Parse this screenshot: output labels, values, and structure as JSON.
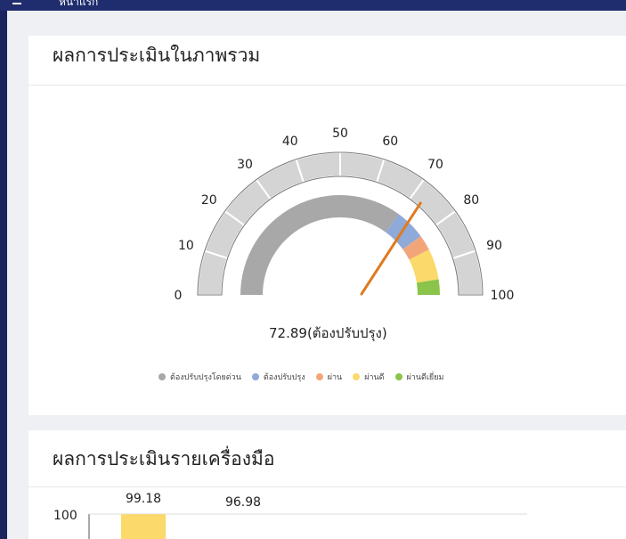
{
  "topbar": {
    "title": "หน้าแรก"
  },
  "overview": {
    "title": "ผลการประเมินในภาพรวม",
    "gauge": {
      "value": 72.89,
      "value_label": "72.89(ต้องปรับปรุง)",
      "ticks": [
        "0",
        "10",
        "20",
        "30",
        "40",
        "50",
        "60",
        "70",
        "80",
        "90",
        "100"
      ],
      "bands": [
        {
          "name": "ต้องปรับปรุงโดยด่วน",
          "from": 0,
          "to": 70,
          "color": "#a8a8a8"
        },
        {
          "name": "ต้องปรับปรุง",
          "from": 70,
          "to": 80,
          "color": "#8fa9d8"
        },
        {
          "name": "ผ่าน",
          "from": 80,
          "to": 85,
          "color": "#f3a57a"
        },
        {
          "name": "ผ่านดี",
          "from": 85,
          "to": 95,
          "color": "#fbd96a"
        },
        {
          "name": "ผ่านดีเยี่ยม",
          "from": 95,
          "to": 100,
          "color": "#8ac44a"
        }
      ],
      "needle_color": "#e07a20"
    },
    "legend": [
      {
        "label": "ต้องปรับปรุงโดยด่วน",
        "color": "#a8a8a8"
      },
      {
        "label": "ต้องปรับปรุง",
        "color": "#8fa9d8"
      },
      {
        "label": "ผ่าน",
        "color": "#f3a57a"
      },
      {
        "label": "ผ่านดี",
        "color": "#fbd96a"
      },
      {
        "label": "ผ่านดีเยี่ยม",
        "color": "#8ac44a"
      }
    ]
  },
  "tools": {
    "title": "ผลการประเมินรายเครื่องมือ",
    "chart_data": {
      "type": "bar",
      "y_tick": "100",
      "values": [
        99.18,
        96.98
      ],
      "value_labels": [
        "99.18",
        "96.98"
      ],
      "bar_color": "#fbd96a"
    }
  }
}
